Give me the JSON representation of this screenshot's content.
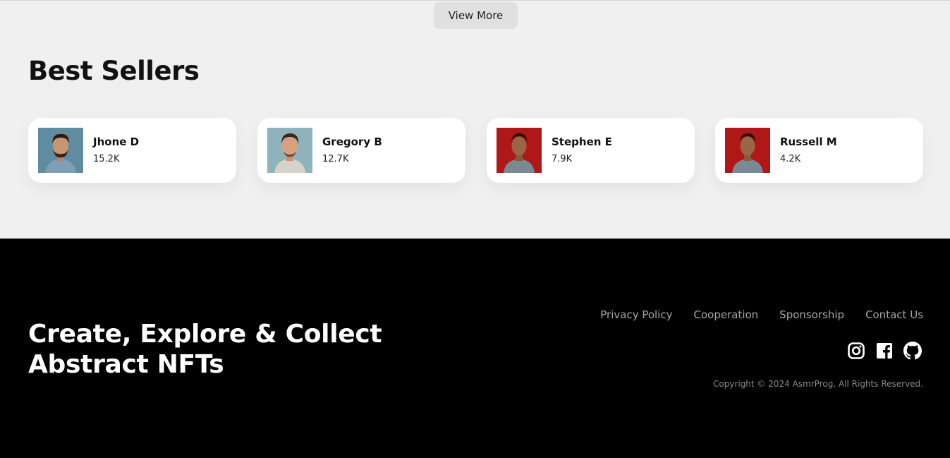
{
  "view_more": {
    "label": "View More"
  },
  "best_sellers": {
    "title": "Best Sellers",
    "items": [
      {
        "name": "Jhone D",
        "value": "15.2K",
        "bg": "#5f8c9e"
      },
      {
        "name": "Gregory B",
        "value": "12.7K",
        "bg": "#8fb3bd"
      },
      {
        "name": "Stephen E",
        "value": "7.9K",
        "bg": "#b01818"
      },
      {
        "name": "Russell M",
        "value": "4.2K",
        "bg": "#b01818"
      }
    ]
  },
  "footer": {
    "tagline_line1": "Create, Explore & Collect",
    "tagline_line2": "Abstract NFTs",
    "links": [
      "Privacy Policy",
      "Cooperation",
      "Sponsorship",
      "Contact Us"
    ],
    "social_icons": [
      "instagram-icon",
      "facebook-icon",
      "github-icon"
    ],
    "copyright": "Copyright © 2024 AsmrProg, All Rights Reserved."
  },
  "colors": {
    "footer_bg": "#000000",
    "page_bg": "#f0f0f0",
    "link": "#a6a6a6"
  }
}
